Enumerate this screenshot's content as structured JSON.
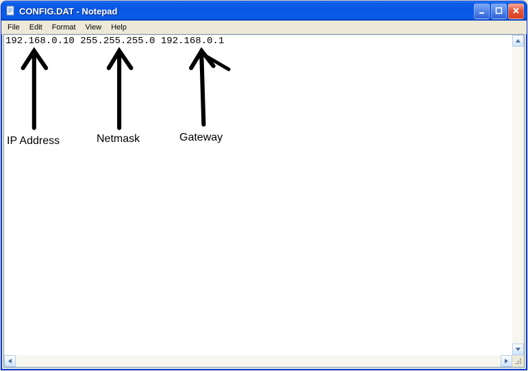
{
  "window": {
    "title": "CONFIG.DAT - Notepad"
  },
  "menu": {
    "file": "File",
    "edit": "Edit",
    "format": "Format",
    "view": "View",
    "help": "Help"
  },
  "editor": {
    "content": "192.168.0.10 255.255.255.0 192.168.0.1"
  },
  "annotations": {
    "ip": "IP Address",
    "netmask": "Netmask",
    "gateway": "Gateway"
  }
}
